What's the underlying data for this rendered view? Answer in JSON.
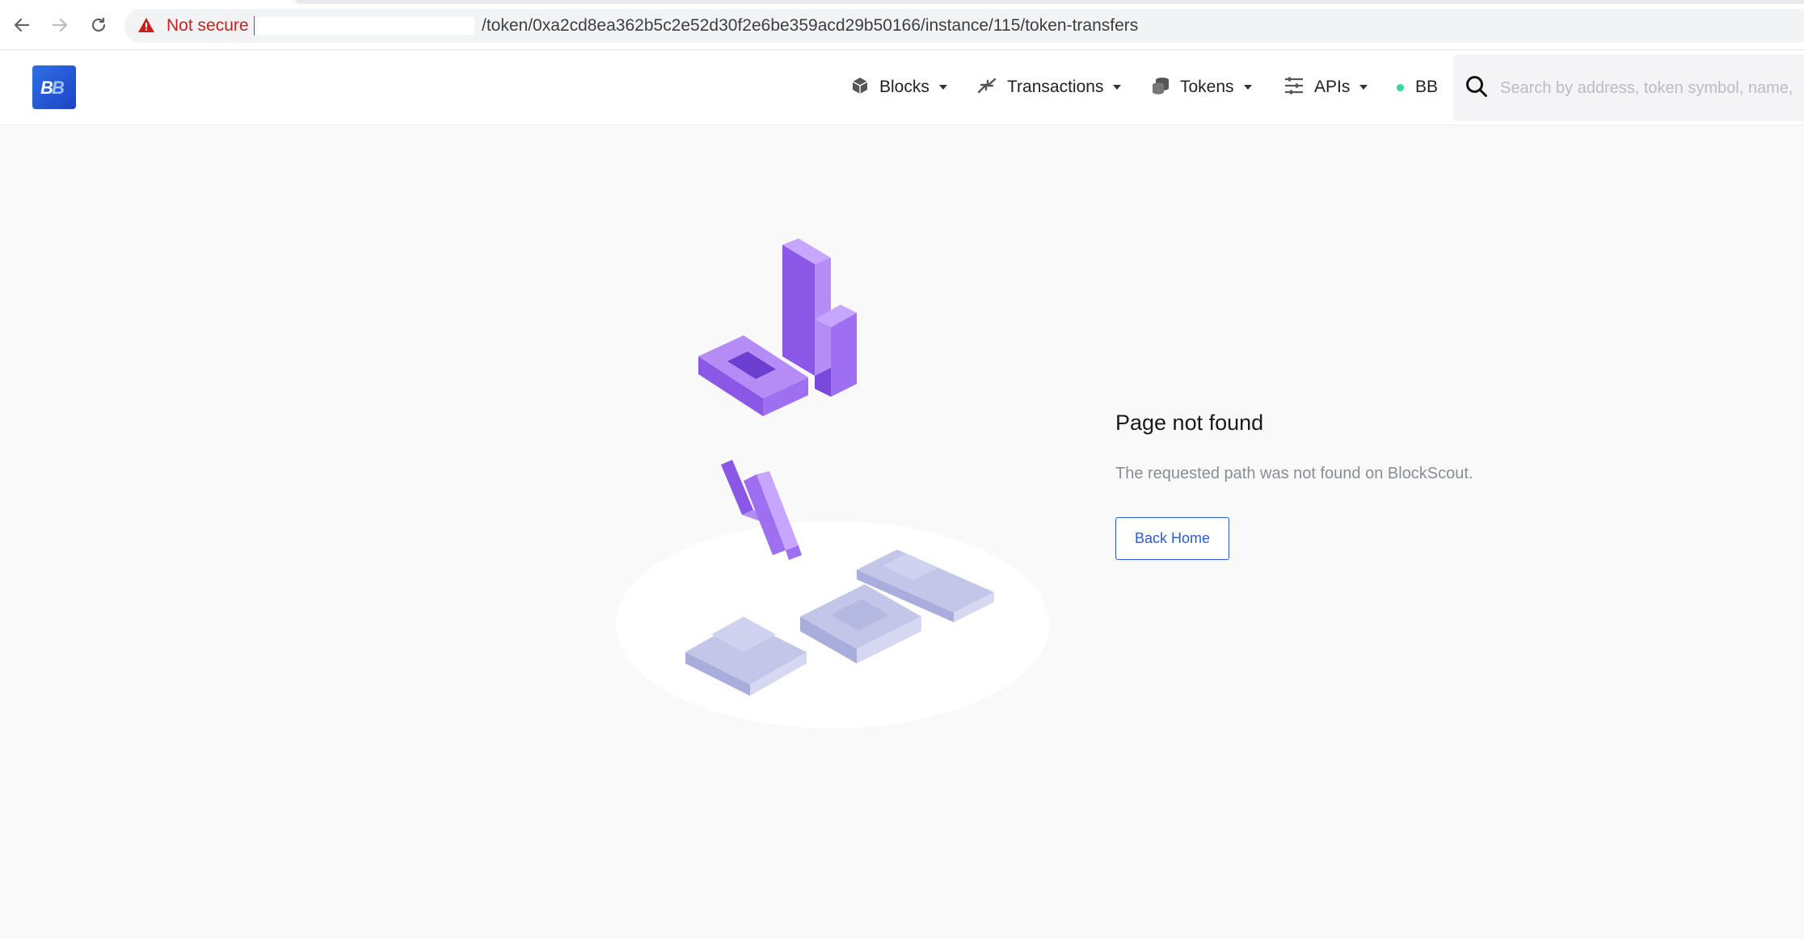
{
  "browser": {
    "security_label": "Not secure",
    "url_path": "/token/0xa2cd8ea362b5c2e52d30f2e6be359acd29b50166/instance/115/token-transfers"
  },
  "header": {
    "logo_text": "BB",
    "nav": [
      {
        "label": "Blocks",
        "icon": "cube-icon"
      },
      {
        "label": "Transactions",
        "icon": "arrows-exchange-icon"
      },
      {
        "label": "Tokens",
        "icon": "coins-stack-icon"
      },
      {
        "label": "APIs",
        "icon": "sliders-icon"
      }
    ],
    "network_label": "BB",
    "network_status_color": "#3dd598",
    "search_placeholder": "Search by address, token symbol, name,"
  },
  "error": {
    "title": "Page not found",
    "description": "The requested path was not found on BlockScout.",
    "button_label": "Back Home"
  },
  "colors": {
    "accent": "#2a5bd7",
    "warning": "#c5221f",
    "illustration_purple": "#8a57e6",
    "illustration_lavender": "#b9bde0"
  }
}
